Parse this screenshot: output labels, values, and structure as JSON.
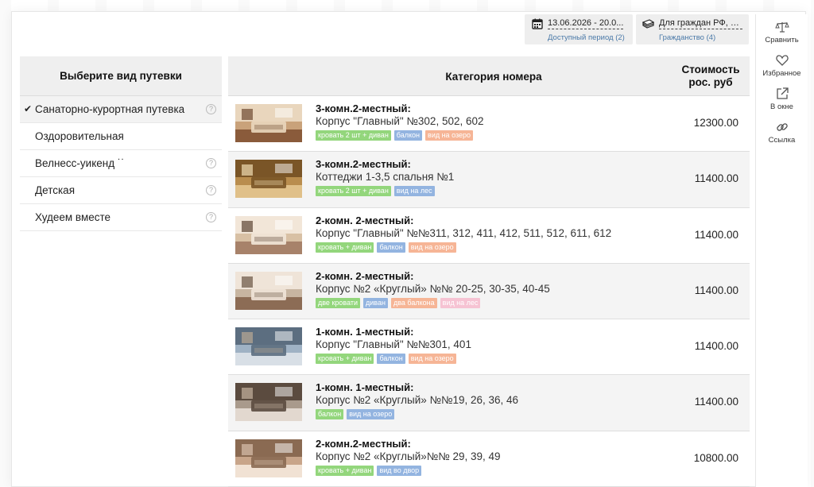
{
  "filters": [
    {
      "value": "13.06.2026 - 20.0...",
      "sub": "Доступный период (2)",
      "icon": "calendar-icon"
    },
    {
      "value": "Для граждан РФ, р...",
      "sub": "Гражданство (4)",
      "icon": "passport-icon"
    }
  ],
  "tools": [
    {
      "label": "Сравнить",
      "icon": "scales-icon"
    },
    {
      "label": "Избранное",
      "icon": "heart-icon"
    },
    {
      "label": "В окне",
      "icon": "external-link-icon"
    },
    {
      "label": "Ссылка",
      "icon": "link-icon"
    }
  ],
  "tour_types": {
    "header": "Выберите вид путевки",
    "items": [
      {
        "label": "Санаторно-курортная путевка",
        "selected": true,
        "help": "?"
      },
      {
        "label": "Оздоровительная",
        "selected": false,
        "help": ""
      },
      {
        "label": "Велнесс-уикенд ˙˙",
        "selected": false,
        "help": "?"
      },
      {
        "label": "Детская",
        "selected": false,
        "help": "?"
      },
      {
        "label": "Худеем вместе",
        "selected": false,
        "help": "?"
      }
    ]
  },
  "table": {
    "col_category": "Категория номера",
    "col_price_1": "Стоимость",
    "col_price_2": "рос. руб"
  },
  "rooms": [
    {
      "title": "3-комн.2-местный:",
      "location": "Корпус \"Главный\" №302, 502, 602",
      "price": "12300.00",
      "tags": [
        {
          "text": "кровать 2 шт + диван",
          "color": "green"
        },
        {
          "text": "балкон",
          "color": "blue"
        },
        {
          "text": "вид на озеро",
          "color": "orange"
        }
      ]
    },
    {
      "title": "3-комн.2-местный:",
      "location": "Коттеджи 1-3,5 спальня №1",
      "price": "11400.00",
      "tags": [
        {
          "text": "кровать 2 шт + диван",
          "color": "green"
        },
        {
          "text": "вид на лес",
          "color": "blue"
        }
      ]
    },
    {
      "title": "2-комн. 2-местный:",
      "location": "Корпус \"Главный\" №№311, 312, 411, 412, 511, 512, 611, 612",
      "price": "11400.00",
      "tags": [
        {
          "text": "кровать + диван",
          "color": "green"
        },
        {
          "text": "балкон",
          "color": "blue"
        },
        {
          "text": "вид на озеро",
          "color": "orange"
        }
      ]
    },
    {
      "title": "2-комн. 2-местный:",
      "location": "Корпус №2 «Круглый» №№ 20-25, 30-35, 40-45",
      "price": "11400.00",
      "tags": [
        {
          "text": "две кровати",
          "color": "green"
        },
        {
          "text": "диван",
          "color": "blue"
        },
        {
          "text": "два балкона",
          "color": "orange"
        },
        {
          "text": "вид на лес",
          "color": "pink"
        }
      ]
    },
    {
      "title": "1-комн. 1-местный:",
      "location": "Корпус \"Главный\" №№301, 401",
      "price": "11400.00",
      "tags": [
        {
          "text": "кровать + диван",
          "color": "green"
        },
        {
          "text": "балкон",
          "color": "blue"
        },
        {
          "text": "вид на озеро",
          "color": "orange"
        }
      ]
    },
    {
      "title": "1-комн. 1-местный:",
      "location": "Корпус №2 «Круглый» №№19, 26, 36, 46",
      "price": "11400.00",
      "tags": [
        {
          "text": "балкон",
          "color": "green"
        },
        {
          "text": "вид на озеро",
          "color": "blue"
        }
      ]
    },
    {
      "title": "2-комн.2-местный:",
      "location": "Корпус №2 «Круглый»№№ 29, 39, 49",
      "price": "10800.00",
      "tags": [
        {
          "text": "кровать + диван",
          "color": "green"
        },
        {
          "text": "вид во двор",
          "color": "blue"
        }
      ]
    }
  ]
}
